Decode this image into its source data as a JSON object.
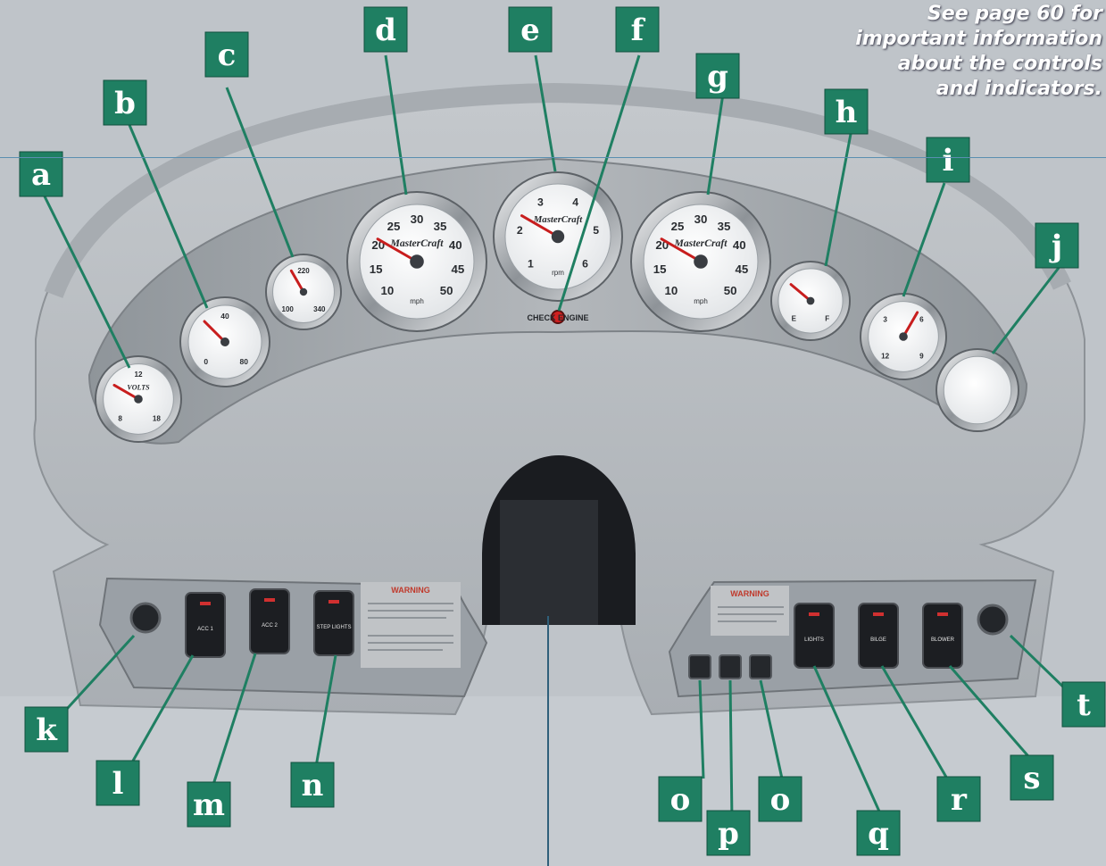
{
  "note": {
    "line1": "See page 60 for",
    "line2": "important information",
    "line3": "about the controls",
    "line4": "and indicators."
  },
  "colors": {
    "label_bg": "#1f7f62",
    "label_text": "#ffffff",
    "leader": "#1f7f62",
    "dash": "#b4b9be",
    "panel": "#9ea3a8",
    "needle": "#c81e1e",
    "gauge_face": "#f5f6f7",
    "bezel": "#d9dcdf"
  },
  "labels": {
    "a": "a",
    "b": "b",
    "c": "c",
    "d": "d",
    "e": "e",
    "f": "f",
    "g": "g",
    "h": "h",
    "i": "i",
    "j": "j",
    "k": "k",
    "l": "l",
    "m": "m",
    "n": "n",
    "o1": "o",
    "p": "p",
    "o2": "o",
    "q": "q",
    "r": "r",
    "s": "s",
    "t": "t"
  },
  "gauges": {
    "a": {
      "brand": "VOLTS",
      "ticks": [
        "8",
        "12",
        "18"
      ]
    },
    "b": {
      "ticks": [
        "0",
        "40",
        "80"
      ]
    },
    "c": {
      "ticks": [
        "100",
        "220",
        "340"
      ]
    },
    "d": {
      "brand": "MasterCraft",
      "ticks": [
        "10",
        "15",
        "20",
        "25",
        "30",
        "35",
        "40",
        "45",
        "50"
      ],
      "unit": "mph"
    },
    "e": {
      "brand": "MasterCraft",
      "ticks": [
        "1",
        "2",
        "3",
        "4",
        "5",
        "6"
      ],
      "unit": "rpm"
    },
    "g": {
      "brand": "MasterCraft",
      "ticks": [
        "10",
        "15",
        "20",
        "25",
        "30",
        "35",
        "40",
        "45",
        "50"
      ],
      "unit": "mph"
    },
    "h": {
      "ticks": [
        "E",
        "F"
      ]
    },
    "i": {
      "ticks": [
        "12",
        "3",
        "6",
        "9"
      ]
    }
  },
  "check_engine": "CHECK ENGINE",
  "switches": {
    "l": "ACC 1",
    "m": "ACC 2",
    "n": "STEP LIGHTS",
    "q": "LIGHTS",
    "r": "BILGE",
    "s": "BLOWER"
  },
  "warning": {
    "left_title": "WARNING",
    "right_title": "WARNING"
  }
}
